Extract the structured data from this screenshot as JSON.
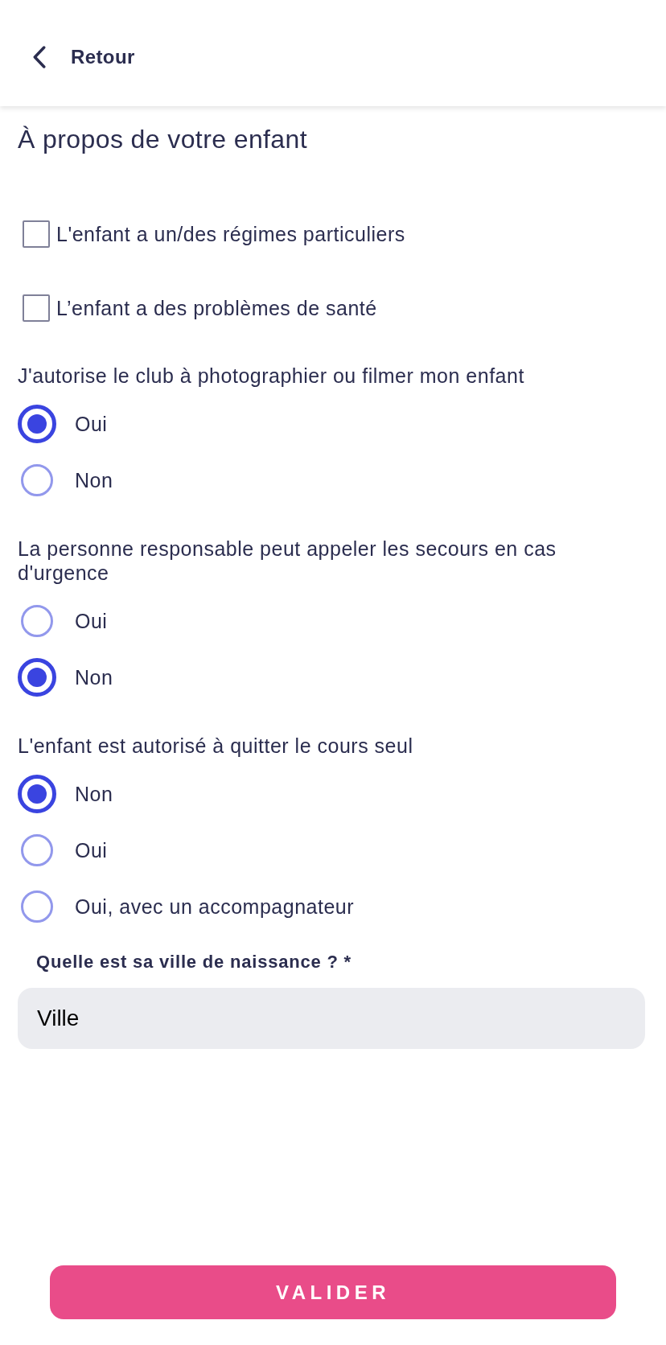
{
  "header": {
    "back_label": "Retour"
  },
  "title": "À propos de votre enfant",
  "checkboxes": [
    {
      "label": "L'enfant a un/des régimes particuliers",
      "checked": false
    },
    {
      "label": "L’enfant a des problèmes de santé",
      "checked": false
    }
  ],
  "questions": [
    {
      "label": "J'autorise le club à photographier ou filmer mon enfant",
      "options": [
        {
          "label": "Oui",
          "selected": true
        },
        {
          "label": "Non",
          "selected": false
        }
      ]
    },
    {
      "label": "La personne responsable peut appeler les secours en cas d'urgence",
      "options": [
        {
          "label": "Oui",
          "selected": false
        },
        {
          "label": "Non",
          "selected": true
        }
      ]
    },
    {
      "label": "L'enfant est autorisé à quitter le cours seul",
      "options": [
        {
          "label": "Non",
          "selected": true
        },
        {
          "label": "Oui",
          "selected": false
        },
        {
          "label": "Oui, avec un accompagnateur",
          "selected": false
        }
      ]
    }
  ],
  "city_field": {
    "label": "Quelle est sa ville de naissance ? *",
    "value": "Ville"
  },
  "submit_button": "VALIDER"
}
